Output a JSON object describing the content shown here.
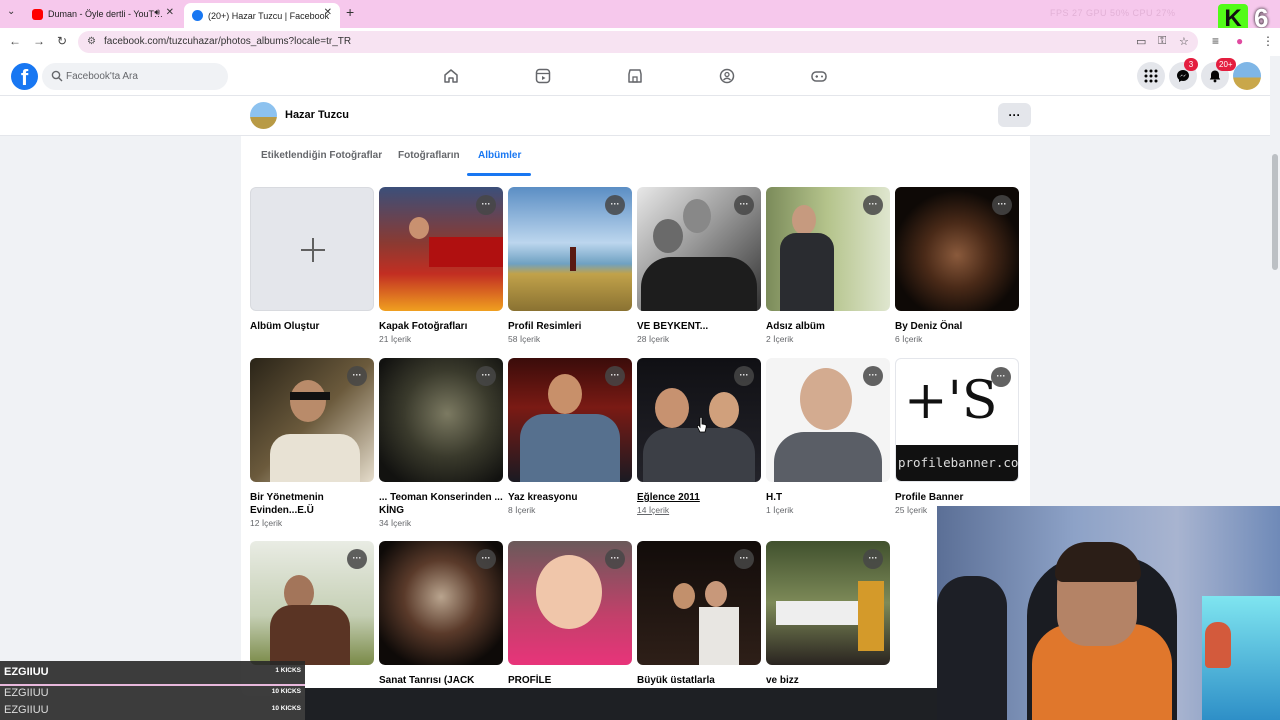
{
  "browser": {
    "tabs": [
      {
        "title": "Duman - Öyle dertli - YouT…",
        "active": false
      },
      {
        "title": "(20+) Hazar Tuzcu | Facebook",
        "active": true
      }
    ],
    "url": "facebook.com/tuzcuhazar/photos_albums?locale=tr_TR",
    "perf_overlay": "FPS 27   GPU 50%   CPU 27%",
    "stream_logo_letter": "K",
    "stream_logo_number": "6"
  },
  "fb": {
    "search_placeholder": "Facebook'ta Ara",
    "messenger_badge": "3",
    "notifications_badge": "20+",
    "profile_name": "Hazar Tuzcu",
    "more_label": "···",
    "tabs": [
      "Etiketlendiğin Fotoğraflar",
      "Fotoğrafların",
      "Albümler"
    ],
    "active_tab": "Albümler",
    "albums": [
      {
        "title": "Albüm Oluştur",
        "count": ""
      },
      {
        "title": "Kapak Fotoğrafları",
        "count": "21 İçerik"
      },
      {
        "title": "Profil Resimleri",
        "count": "58 İçerik"
      },
      {
        "title": "VE BEYKENT...",
        "count": "28 İçerik"
      },
      {
        "title": "Adsız albüm",
        "count": "2 İçerik"
      },
      {
        "title": "By Deniz Önal",
        "count": "6 İçerik"
      },
      {
        "title": "Bir Yönetmenin Evinden...E.Ü",
        "count": "12 İçerik"
      },
      {
        "title": "... Teoman Konserinden ... KİNG",
        "count": "34 İçerik"
      },
      {
        "title": "Yaz kreasyonu",
        "count": "8 İçerik"
      },
      {
        "title": "Eğlence 2011",
        "count": "14 İçerik"
      },
      {
        "title": "H.T",
        "count": "1 İçerik"
      },
      {
        "title": "Profile Banner",
        "count": "25 İçerik"
      },
      {
        "title": "",
        "count": ""
      },
      {
        "title": "Sanat Tanrısı (JACK",
        "count": ""
      },
      {
        "title": "PROFİLE",
        "count": ""
      },
      {
        "title": "Büyük üstatlarla",
        "count": ""
      },
      {
        "title": "ve bizz",
        "count": ""
      }
    ],
    "banner_text": "profilebanner.com",
    "banner_glyph": "+'S"
  },
  "stream": {
    "kicks": [
      {
        "name": "EZGIIUU",
        "amount": "1 KICKS"
      },
      {
        "name": "EZGIIUU",
        "amount": "10 KICKS"
      },
      {
        "name": "EZGIIUU",
        "amount": "10 KICKS"
      }
    ]
  },
  "colors": {
    "fb_blue": "#1877f2",
    "tabbar_pink": "#f6c8ec",
    "badge_red": "#e41e3f",
    "kick_green": "#53fc18"
  }
}
